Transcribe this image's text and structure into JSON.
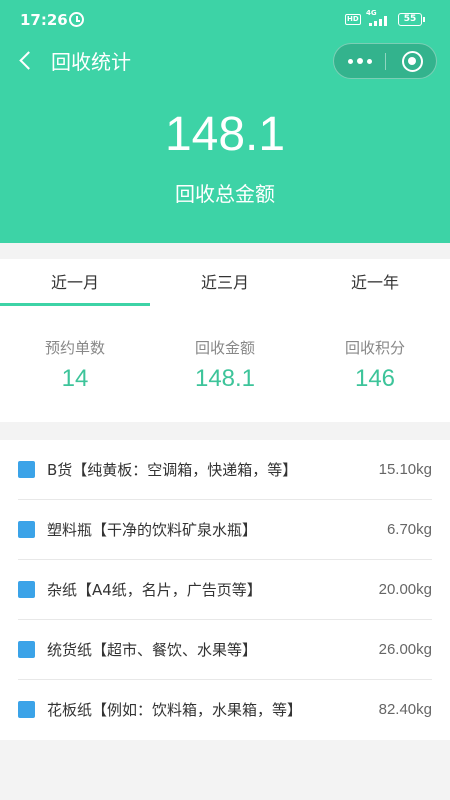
{
  "status_bar": {
    "time": "17:26",
    "hd": "HD",
    "network": "4G",
    "battery": "55"
  },
  "nav": {
    "title": "回收统计"
  },
  "summary": {
    "total_amount": "148.1",
    "total_label": "回收总金额"
  },
  "tabs": [
    {
      "label": "近一月",
      "active": true
    },
    {
      "label": "近三月",
      "active": false
    },
    {
      "label": "近一年",
      "active": false
    }
  ],
  "stats": [
    {
      "label": "预约单数",
      "value": "14"
    },
    {
      "label": "回收金额",
      "value": "148.1"
    },
    {
      "label": "回收积分",
      "value": "146"
    }
  ],
  "items": [
    {
      "name": "B货【纯黄板：空调箱，快递箱，等】",
      "weight": "15.10kg"
    },
    {
      "name": "塑料瓶【干净的饮料矿泉水瓶】",
      "weight": "6.70kg"
    },
    {
      "name": "杂纸【A4纸，名片，广告页等】",
      "weight": "20.00kg"
    },
    {
      "name": "统货纸【超市、餐饮、水果等】",
      "weight": "26.00kg"
    },
    {
      "name": "花板纸【例如：饮料箱，水果箱，等】",
      "weight": "82.40kg"
    }
  ],
  "colors": {
    "accent": "#3dd3a6",
    "stat_value": "#3dc49a",
    "item_marker": "#3ba3e8",
    "background": "#f3f3f3"
  }
}
